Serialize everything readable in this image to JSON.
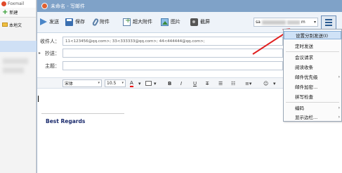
{
  "left_app": {
    "title": "Foxmail",
    "new_button": "新建",
    "local_folder": "本地文"
  },
  "window": {
    "title": "未命名 - 写邮件"
  },
  "toolbar": {
    "send": "发送",
    "save": "保存",
    "attach": "附件",
    "big_attach": "超大附件",
    "image": "图片",
    "screenshot": "截屏",
    "account_prefix": "sa",
    "account_suffix": "m"
  },
  "fields": {
    "to_label": "收件人：",
    "to_value": "11<123456@qq.com>; 33<333333@qq.com>; 44<444444@qq.com>;",
    "cc_label": "抄送：",
    "cc_value": "",
    "subject_label": "主题：",
    "subject_value": ""
  },
  "format_bar": {
    "font": "宋体",
    "size": "10.5",
    "font_color_glyph": "A",
    "bold": "B",
    "italic": "I",
    "underline": "U",
    "strike": "T"
  },
  "body": {
    "signature": "Best Regards"
  },
  "menu": {
    "items": [
      {
        "label": "设置分别发送(I)",
        "highlighted": true,
        "submenu": false
      },
      {
        "label": "定时发送",
        "highlighted": false,
        "submenu": false
      },
      {
        "label": "会议请求",
        "highlighted": false,
        "submenu": false
      },
      {
        "label": "阅读收条",
        "highlighted": false,
        "submenu": false
      },
      {
        "label": "邮件优先级",
        "highlighted": false,
        "submenu": true
      },
      {
        "label": "邮件加密...",
        "highlighted": false,
        "submenu": false
      },
      {
        "label": "拼写检查",
        "highlighted": false,
        "submenu": false
      },
      {
        "label": "编码",
        "highlighted": false,
        "submenu": true
      },
      {
        "label": "显示边栏...",
        "highlighted": false,
        "submenu": true
      }
    ]
  },
  "colors": {
    "title_bar": "#7fa2c8",
    "menu_highlight": "#cfe2f7",
    "annotation_arrow": "#e02020",
    "signature_text": "#1a2a6c"
  }
}
